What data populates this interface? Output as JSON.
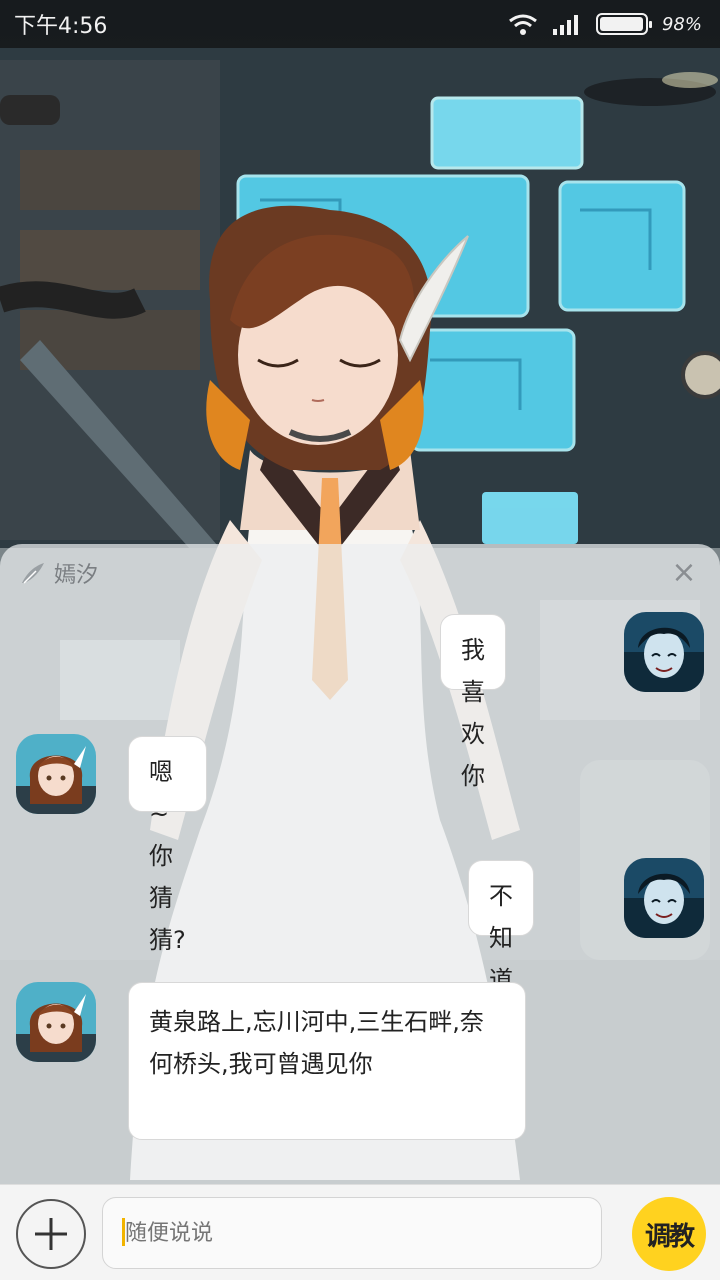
{
  "status_bar": {
    "time": "下午4:56",
    "battery_text": "98%",
    "battery_level": 0.98,
    "icons": [
      "wifi-icon",
      "signal-icon",
      "battery-icon"
    ]
  },
  "chat": {
    "contact_name": "嫣汐",
    "close_label": "×",
    "messages": [
      {
        "from": "user",
        "text": "我喜欢你"
      },
      {
        "from": "bot",
        "text": "嗯~你猜猜?"
      },
      {
        "from": "user",
        "text": "不知道"
      },
      {
        "from": "bot",
        "text": "黄泉路上,忘川河中,三生石畔,奈何桥头,我可曾遇见你"
      }
    ]
  },
  "input": {
    "placeholder": "随便说说",
    "plus_label": "+",
    "train_label": "调教"
  },
  "colors": {
    "accent": "#ffd21f",
    "caret": "#f2b400",
    "bubble": "#ffffff",
    "panel": "#eceef0"
  }
}
